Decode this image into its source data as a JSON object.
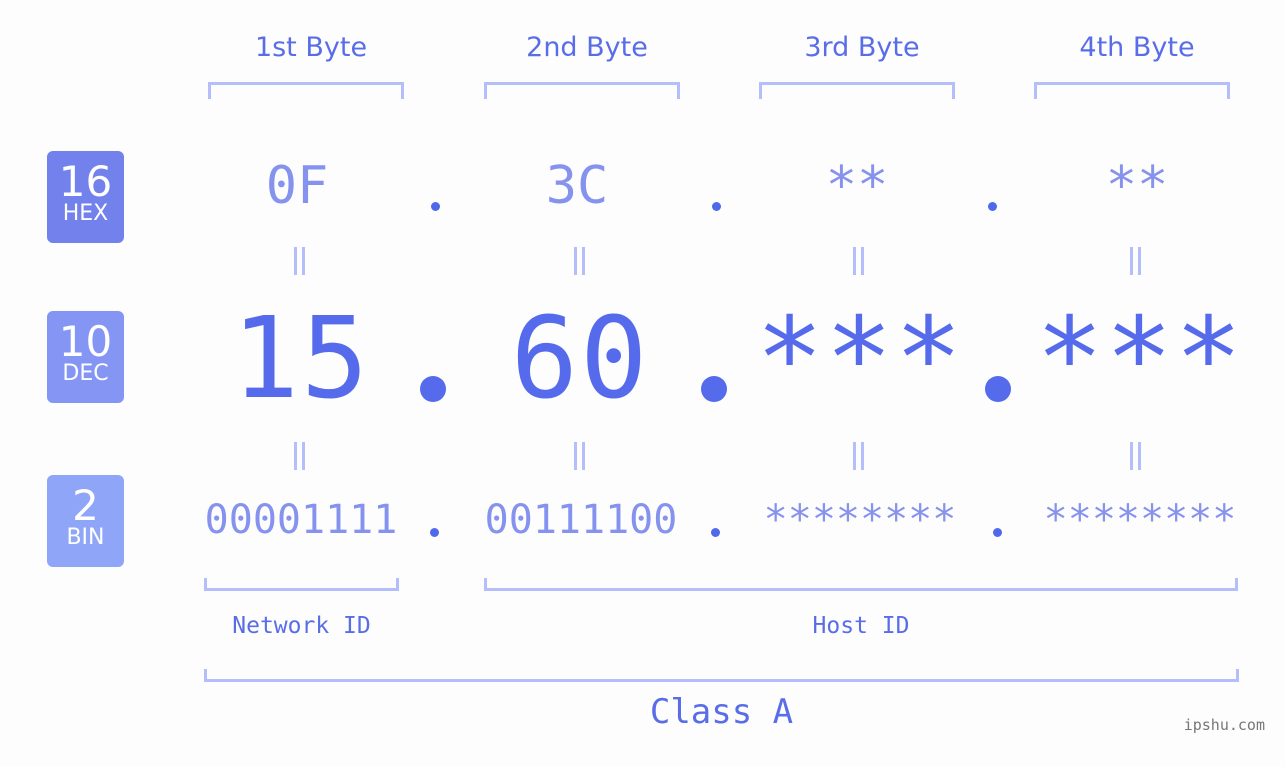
{
  "byte_headers": [
    "1st Byte",
    "2nd Byte",
    "3rd Byte",
    "4th Byte"
  ],
  "badges": {
    "hex": {
      "num": "16",
      "label": "HEX",
      "color": "#7281ec"
    },
    "dec": {
      "num": "10",
      "label": "DEC",
      "color": "#8595f3"
    },
    "bin": {
      "num": "2",
      "label": "BIN",
      "color": "#8fa6f8"
    }
  },
  "hex_values": [
    "0F",
    "3C",
    "**",
    "**"
  ],
  "dec_values": [
    "15",
    "60",
    "***",
    "***"
  ],
  "bin_values": [
    "00001111",
    "00111100",
    "********",
    "********"
  ],
  "labels": {
    "network_id": "Network ID",
    "host_id": "Host ID",
    "class": "Class A"
  },
  "watermark": "ipshu.com",
  "colors": {
    "primary": "#566bec",
    "light": "#8592ee",
    "bracket": "#b3befa"
  }
}
